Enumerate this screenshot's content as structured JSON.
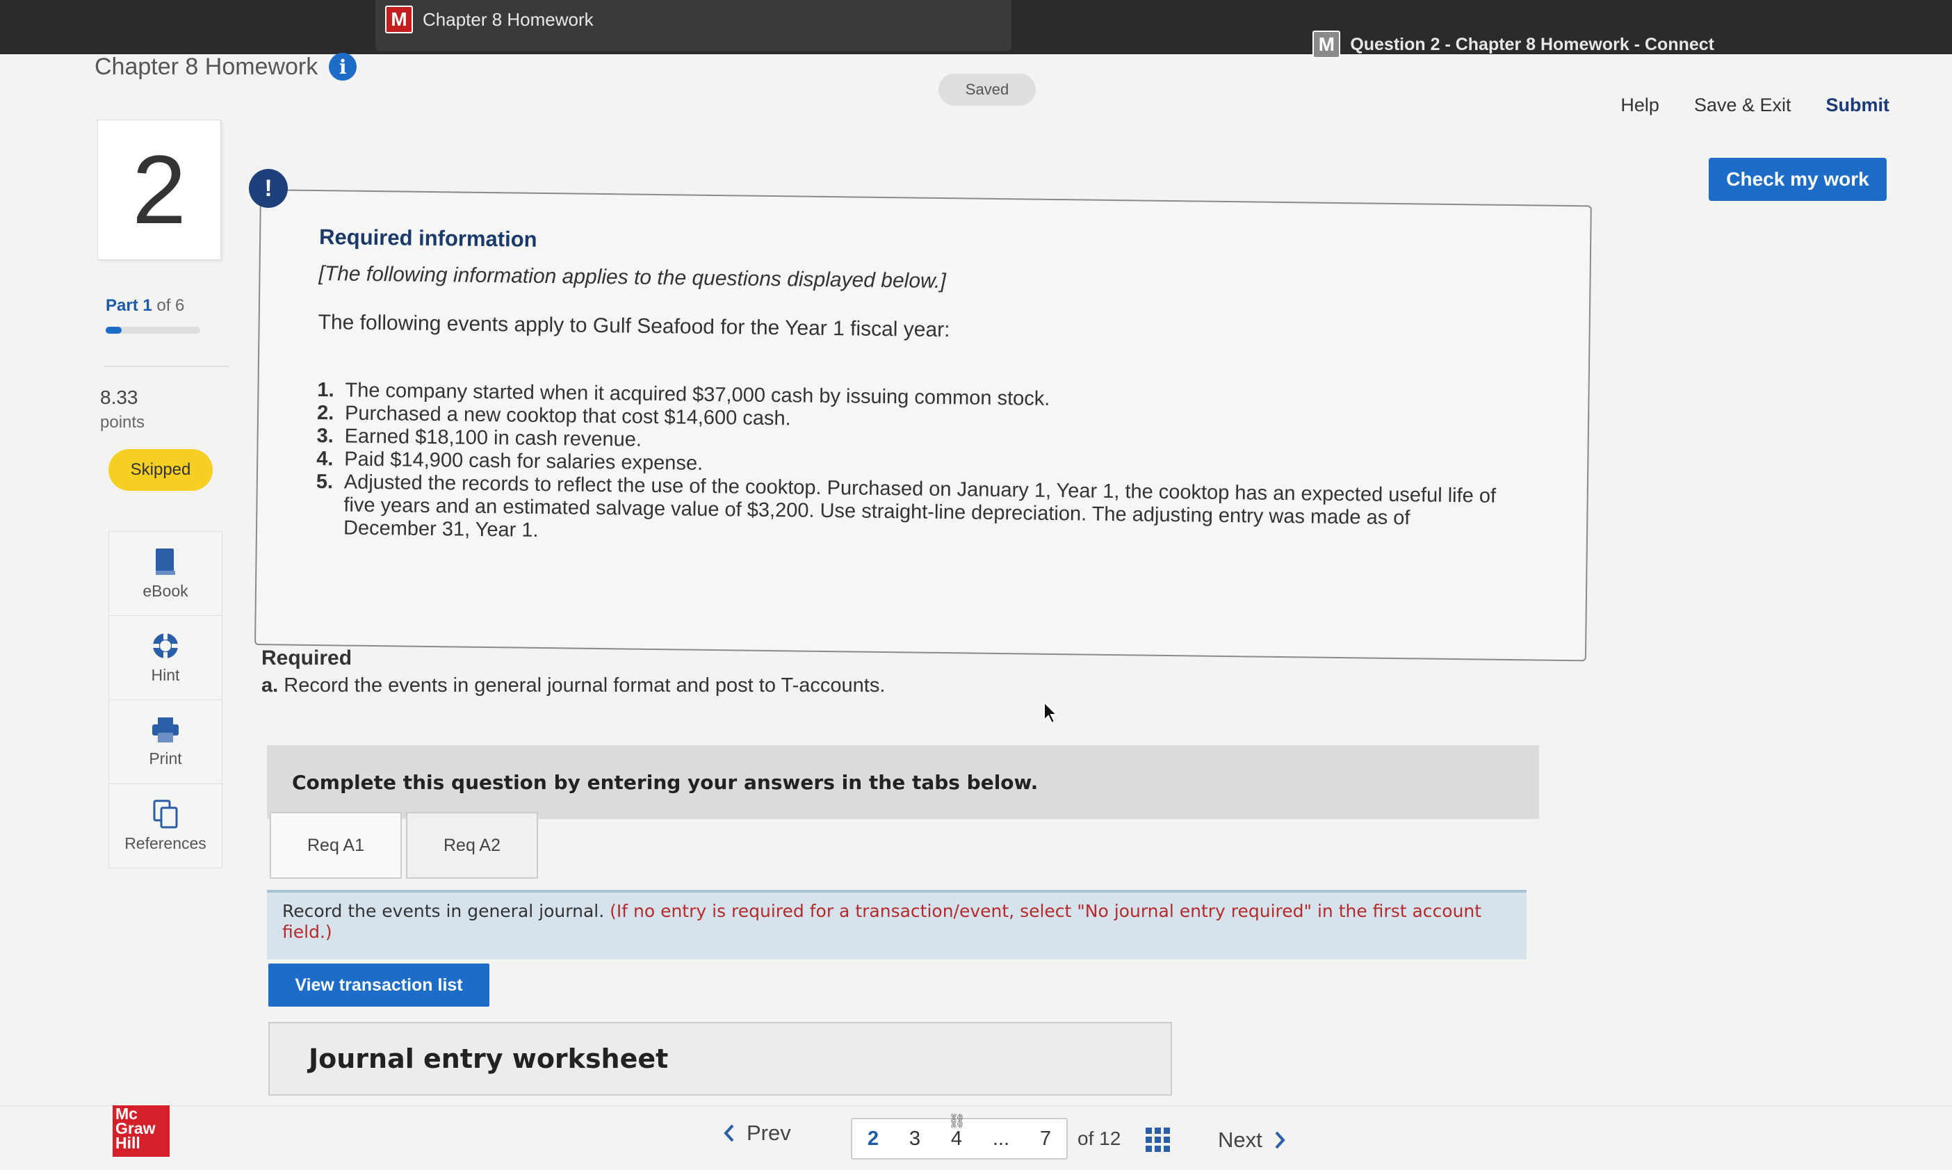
{
  "browser": {
    "active_tab": "Chapter 8 Homework",
    "right_tab": "Question 2 - Chapter 8 Homework - Connect",
    "tab_badge": "M"
  },
  "header": {
    "title": "Chapter 8 Homework",
    "info_icon": "i",
    "saved": "Saved",
    "help": "Help",
    "save_exit": "Save & Exit",
    "submit": "Submit",
    "check_my_work": "Check my work"
  },
  "rail": {
    "question_number": "2",
    "part_label": "Part 1",
    "part_of": " of 6",
    "part_progress": 0.17,
    "points_value": "8.33",
    "points_label": "points",
    "status_badge": "Skipped",
    "tools": [
      {
        "label": "eBook",
        "icon": "book-icon"
      },
      {
        "label": "Hint",
        "icon": "lifebuoy-icon"
      },
      {
        "label": "Print",
        "icon": "printer-icon"
      },
      {
        "label": "References",
        "icon": "copy-icon"
      }
    ]
  },
  "info": {
    "alert_icon": "!",
    "title": "Required information",
    "note": "[The following information applies to the questions displayed below.]",
    "intro": "The following events apply to Gulf Seafood for the Year 1 fiscal year:",
    "events": [
      {
        "num": "1.",
        "text": "The company started when it acquired $37,000 cash by issuing common stock."
      },
      {
        "num": "2.",
        "text": "Purchased a new cooktop that cost $14,600 cash."
      },
      {
        "num": "3.",
        "text": "Earned $18,100 in cash revenue."
      },
      {
        "num": "4.",
        "text": "Paid $14,900 cash for salaries expense."
      },
      {
        "num": "5.",
        "text": "Adjusted the records to reflect the use of the cooktop. Purchased on January 1, Year 1, the cooktop has an expected useful life of five years and an estimated salvage value of $3,200. Use straight-line depreciation. The adjusting entry was made as of December 31, Year 1."
      }
    ]
  },
  "required": {
    "heading": "Required",
    "a_label": "a.",
    "a_text": " Record the events in general journal format and post to T-accounts."
  },
  "work": {
    "complete_text": "Complete this question by entering your answers in the tabs below.",
    "tabs": [
      "Req A1",
      "Req A2"
    ],
    "instruction": "Record the events in general journal. ",
    "instruction_note": "(If no entry is required for a transaction/event, select \"No journal entry required\" in the first account field.)",
    "view_transactions": "View transaction list",
    "worksheet_title": "Journal entry worksheet"
  },
  "footer": {
    "logo_lines": [
      "Mc",
      "Graw",
      "Hill"
    ],
    "prev": "Prev",
    "pages": [
      "2",
      "3",
      "4",
      "...",
      "7"
    ],
    "of_total": "of 12",
    "next": "Next"
  },
  "colors": {
    "accent": "#1d6cc8",
    "skipped": "#f6cf23",
    "brand_red": "#d3202b"
  }
}
